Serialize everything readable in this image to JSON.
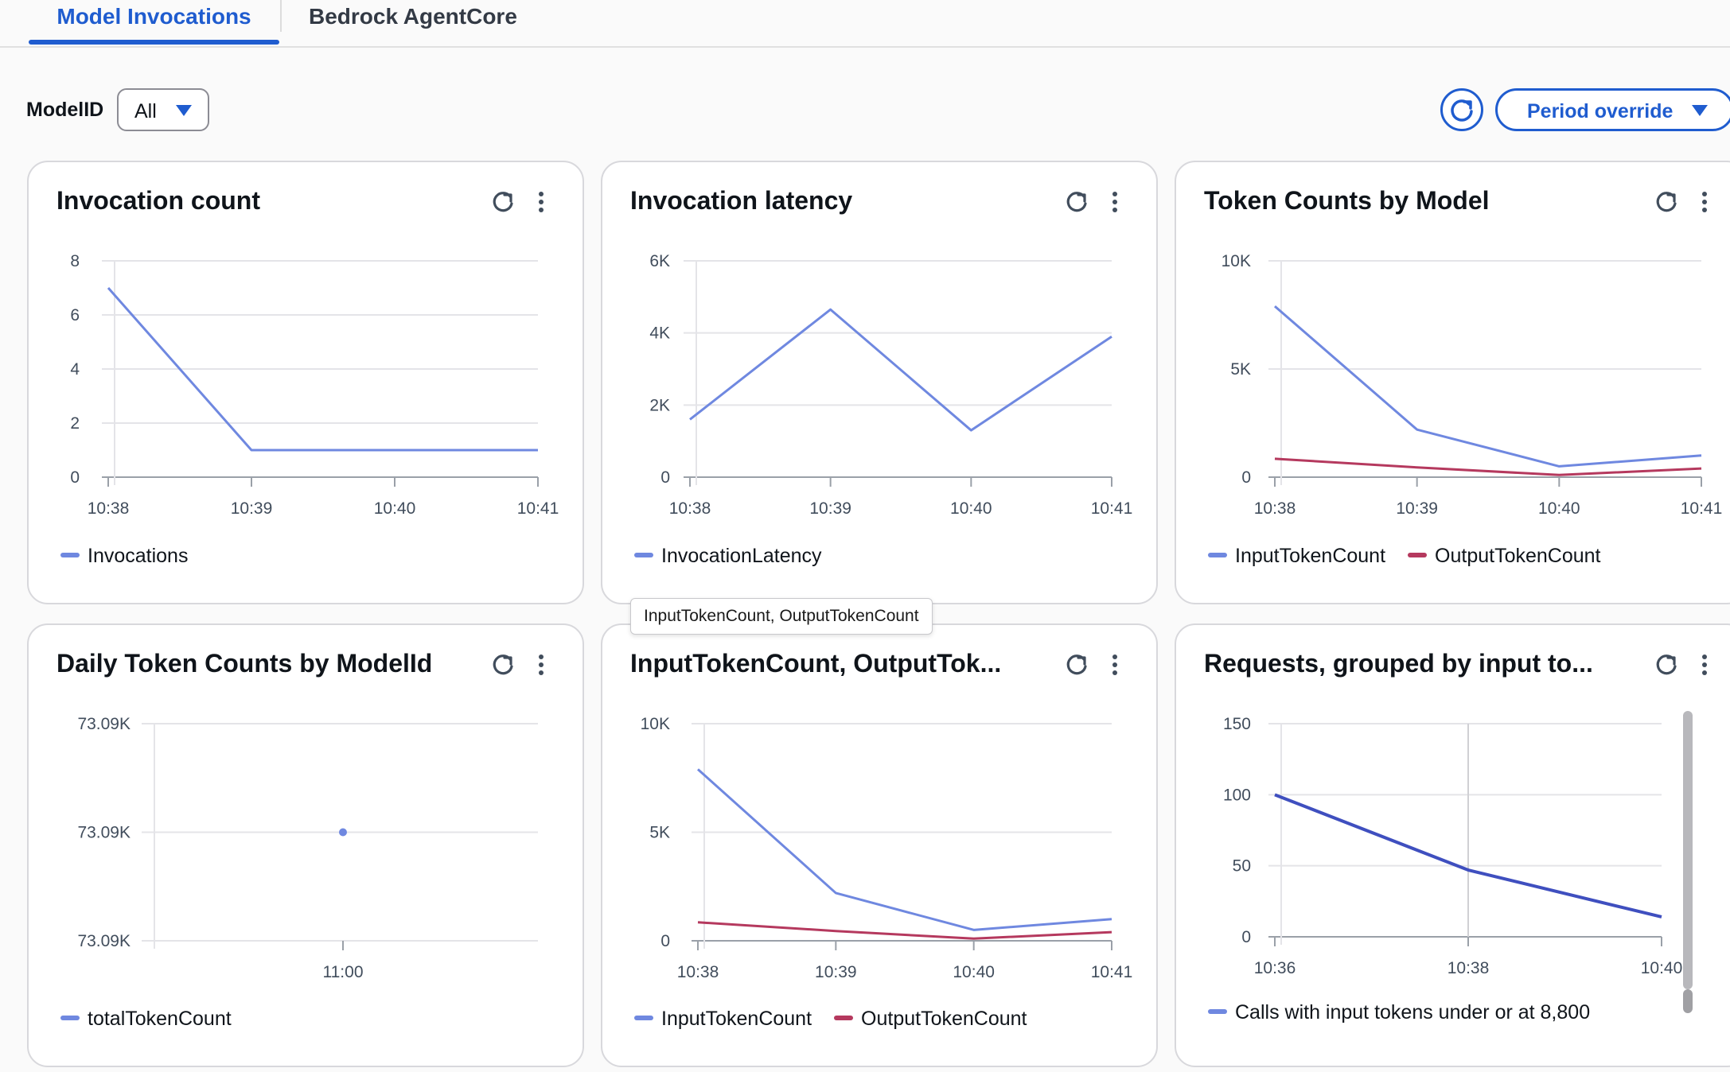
{
  "tabs": [
    {
      "label": "Model Invocations",
      "active": true
    },
    {
      "label": "Bedrock AgentCore",
      "active": false
    }
  ],
  "filter": {
    "label": "ModelID",
    "value": "All"
  },
  "toolbar": {
    "period_label": "Period override"
  },
  "tooltip": "InputTokenCount, OutputTokenCount",
  "colors": {
    "accent": "#1f5ccf",
    "series_blue": "#6f88e0",
    "series_red": "#b5395e",
    "series_navy": "#3f4fbf"
  },
  "panels": [
    {
      "title": "Invocation count",
      "legend": [
        "Invocations"
      ]
    },
    {
      "title": "Invocation latency",
      "legend": [
        "InvocationLatency"
      ]
    },
    {
      "title": "Token Counts by Model",
      "legend": [
        "InputTokenCount",
        "OutputTokenCount"
      ]
    },
    {
      "title": "Daily Token Counts by ModelId",
      "legend": [
        "totalTokenCount"
      ]
    },
    {
      "title": "InputTokenCount, OutputTok...",
      "legend": [
        "InputTokenCount",
        "OutputTokenCount"
      ]
    },
    {
      "title": "Requests, grouped by input to...",
      "legend": [
        "Calls with input tokens under or at 8,800"
      ]
    }
  ],
  "chart_data": [
    {
      "type": "line",
      "x": [
        "10:38",
        "10:39",
        "10:40",
        "10:41"
      ],
      "yticks": [
        "0",
        "2",
        "4",
        "6",
        "8"
      ],
      "ylim": [
        0,
        8
      ],
      "series": [
        {
          "name": "Invocations",
          "values": [
            7,
            1,
            1,
            1
          ]
        }
      ]
    },
    {
      "type": "line",
      "x": [
        "10:38",
        "10:39",
        "10:40",
        "10:41"
      ],
      "yticks": [
        "0",
        "2K",
        "4K",
        "6K"
      ],
      "ylim": [
        0,
        6000
      ],
      "series": [
        {
          "name": "InvocationLatency",
          "values": [
            1600,
            4650,
            1300,
            3900
          ]
        }
      ]
    },
    {
      "type": "line",
      "x": [
        "10:38",
        "10:39",
        "10:40",
        "10:41"
      ],
      "yticks": [
        "0",
        "5K",
        "10K"
      ],
      "ylim": [
        0,
        10000
      ],
      "series": [
        {
          "name": "InputTokenCount",
          "values": [
            7900,
            2200,
            500,
            1000
          ]
        },
        {
          "name": "OutputTokenCount",
          "values": [
            850,
            450,
            100,
            400
          ]
        }
      ]
    },
    {
      "type": "scatter",
      "x": [
        "11:00"
      ],
      "yticks": [
        "73.09K",
        "73.09K",
        "73.09K"
      ],
      "ylim": [
        0,
        2
      ],
      "series": [
        {
          "name": "totalTokenCount",
          "values": [
            1
          ]
        }
      ]
    },
    {
      "type": "line",
      "x": [
        "10:38",
        "10:39",
        "10:40",
        "10:41"
      ],
      "yticks": [
        "0",
        "5K",
        "10K"
      ],
      "ylim": [
        0,
        10000
      ],
      "series": [
        {
          "name": "InputTokenCount",
          "values": [
            7900,
            2200,
            500,
            1000
          ]
        },
        {
          "name": "OutputTokenCount",
          "values": [
            850,
            450,
            100,
            400
          ]
        }
      ]
    },
    {
      "type": "line",
      "x": [
        "10:36",
        "10:38",
        "10:40"
      ],
      "yticks": [
        "0",
        "50",
        "100",
        "150"
      ],
      "ylim": [
        0,
        150
      ],
      "series": [
        {
          "name": "Calls with input tokens under or at 8,800",
          "values": [
            100,
            47,
            14
          ]
        }
      ]
    }
  ]
}
